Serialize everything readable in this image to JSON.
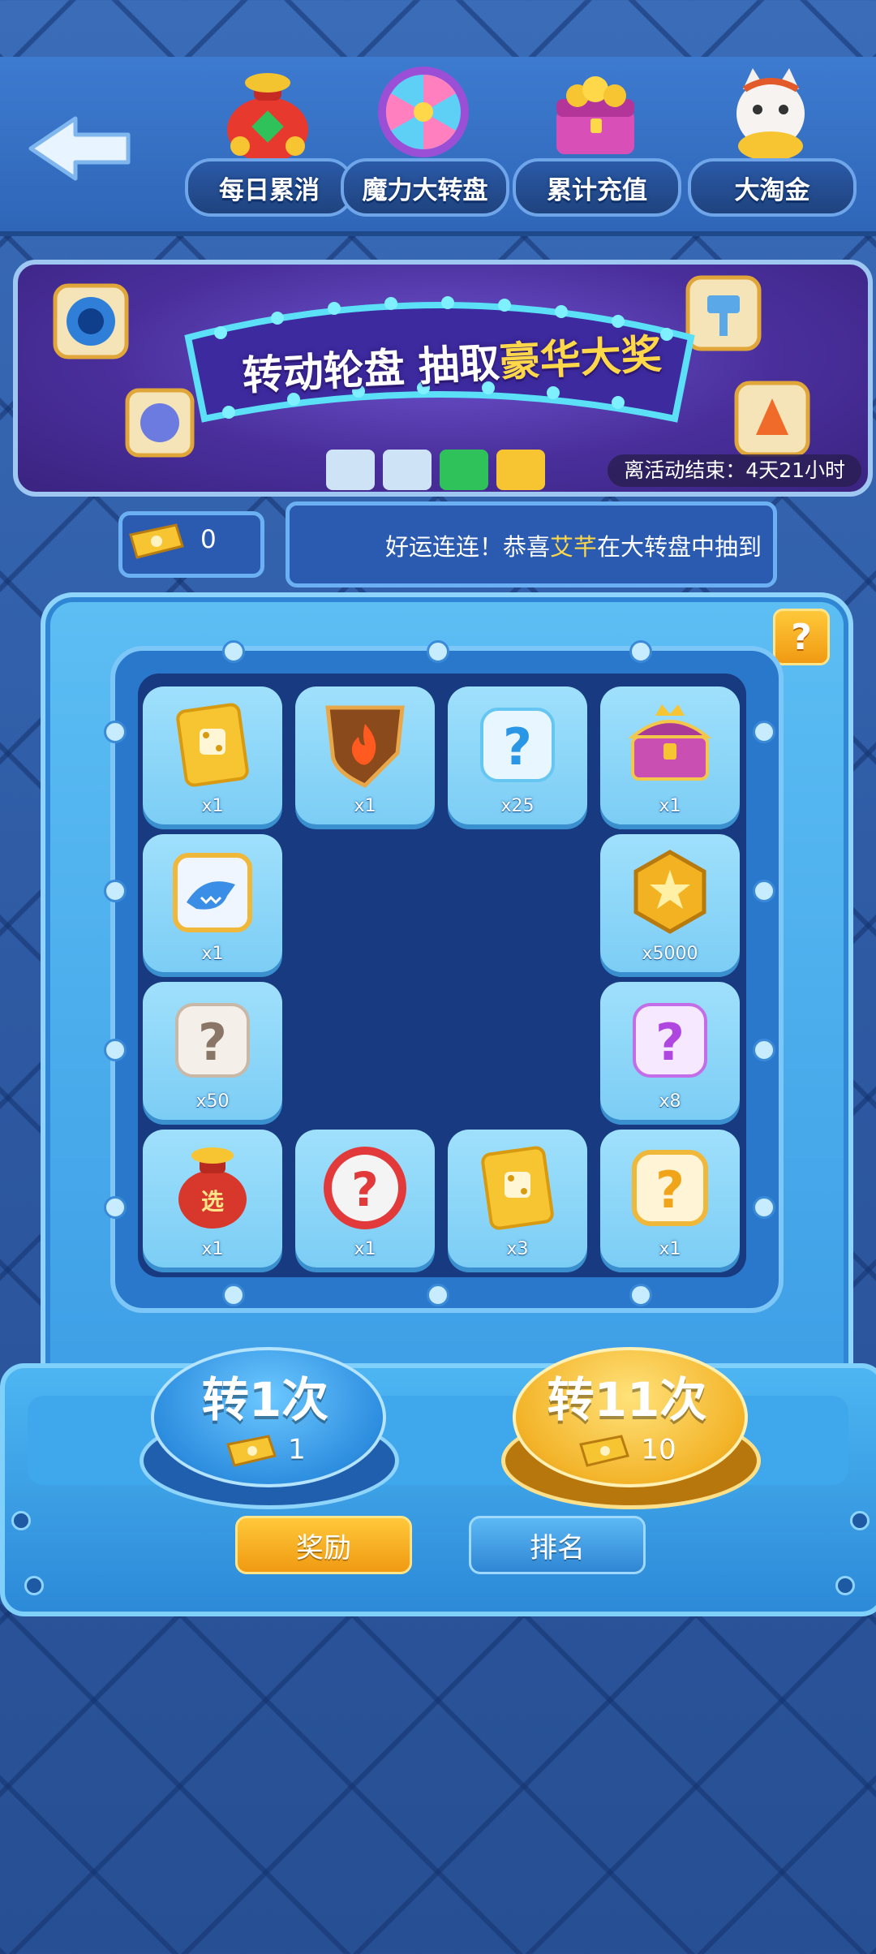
{
  "nav": {
    "items": [
      {
        "label": "每日累消",
        "icon": "money-bag-icon"
      },
      {
        "label": "魔力大转盘",
        "icon": "wheel-icon"
      },
      {
        "label": "累计充值",
        "icon": "treasure-chest-icon"
      },
      {
        "label": "大淘金",
        "icon": "lucky-cat-icon"
      }
    ]
  },
  "banner": {
    "title_part1": "转动轮盘 抽取",
    "title_part2": "豪华大奖",
    "timer": "离活动结束：4天21小时"
  },
  "ticket": {
    "count": "0"
  },
  "marquee": {
    "prefix": "好运连连！恭喜",
    "name": "艾芊",
    "suffix": "在大转盘中抽到"
  },
  "help_label": "?",
  "grid": {
    "cells": [
      {
        "qty": "x1",
        "icon": "dice-card-icon"
      },
      {
        "qty": "x1",
        "icon": "fire-shield-icon"
      },
      {
        "qty": "x25",
        "icon": "mystery-box-blue-icon"
      },
      {
        "qty": "x1",
        "icon": "treasure-chest-icon"
      },
      {
        "qty": "x1",
        "icon": "shark-card-icon"
      },
      {
        "qty": "x5000",
        "icon": "gold-coin-icon"
      },
      {
        "qty": "x50",
        "icon": "mystery-box-white-icon"
      },
      {
        "qty": "x8",
        "icon": "mystery-box-purple-icon"
      },
      {
        "qty": "x1",
        "icon": "lucky-bag-icon",
        "bag_text": "选"
      },
      {
        "qty": "x1",
        "icon": "mystery-ball-red-icon"
      },
      {
        "qty": "x3",
        "icon": "dice-card-icon"
      },
      {
        "qty": "x1",
        "icon": "mystery-box-gold-icon"
      }
    ]
  },
  "spin_once": {
    "label": "转1次",
    "cost": "1"
  },
  "spin_eleven": {
    "label": "转11次",
    "cost": "10"
  },
  "buttons": {
    "rewards": "奖励",
    "ranking": "排名"
  },
  "colors": {
    "accent_gold": "#ffd84a",
    "board": "#173a80"
  }
}
